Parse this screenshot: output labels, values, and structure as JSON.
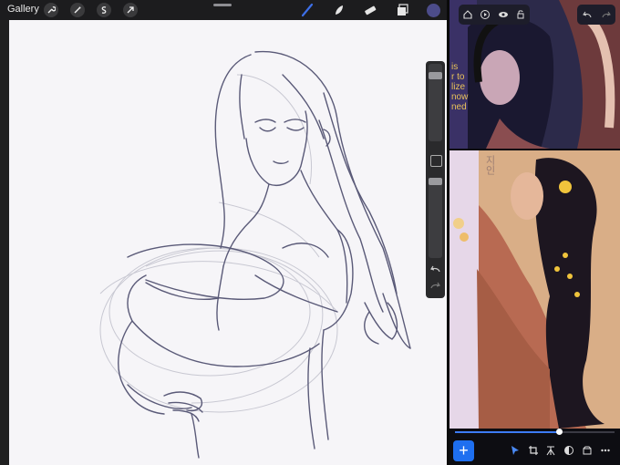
{
  "topbar": {
    "gallery_label": "Gallery",
    "left_icons": [
      "wrench-icon",
      "magic-wand-icon",
      "selection-s-icon",
      "transform-arrow-icon"
    ],
    "right_icons": [
      "brush-icon",
      "smudge-icon",
      "eraser-icon",
      "layers-icon",
      "color-swatch"
    ],
    "brush_color": "#3d6fe8",
    "swatch_color": "#4c4c8a"
  },
  "sidebar": {
    "size_slider_level": 0.12,
    "opacity_slider_level": 0.0
  },
  "reference_panel": {
    "caption_lines": [
      "is",
      "r to",
      "lize",
      "now",
      "ned"
    ],
    "korean_text": "지인"
  },
  "right_toolbar": {
    "icons": [
      "home-icon",
      "play-icon",
      "eye-icon",
      "lock-icon",
      "undo-icon",
      "redo-icon"
    ]
  },
  "bottom_toolbar": {
    "add_label": "+",
    "icons": [
      "pointer-icon",
      "crop-icon",
      "text-icon",
      "adjust-icon",
      "box-icon",
      "more-icon"
    ],
    "timeline_progress": 0.65
  }
}
